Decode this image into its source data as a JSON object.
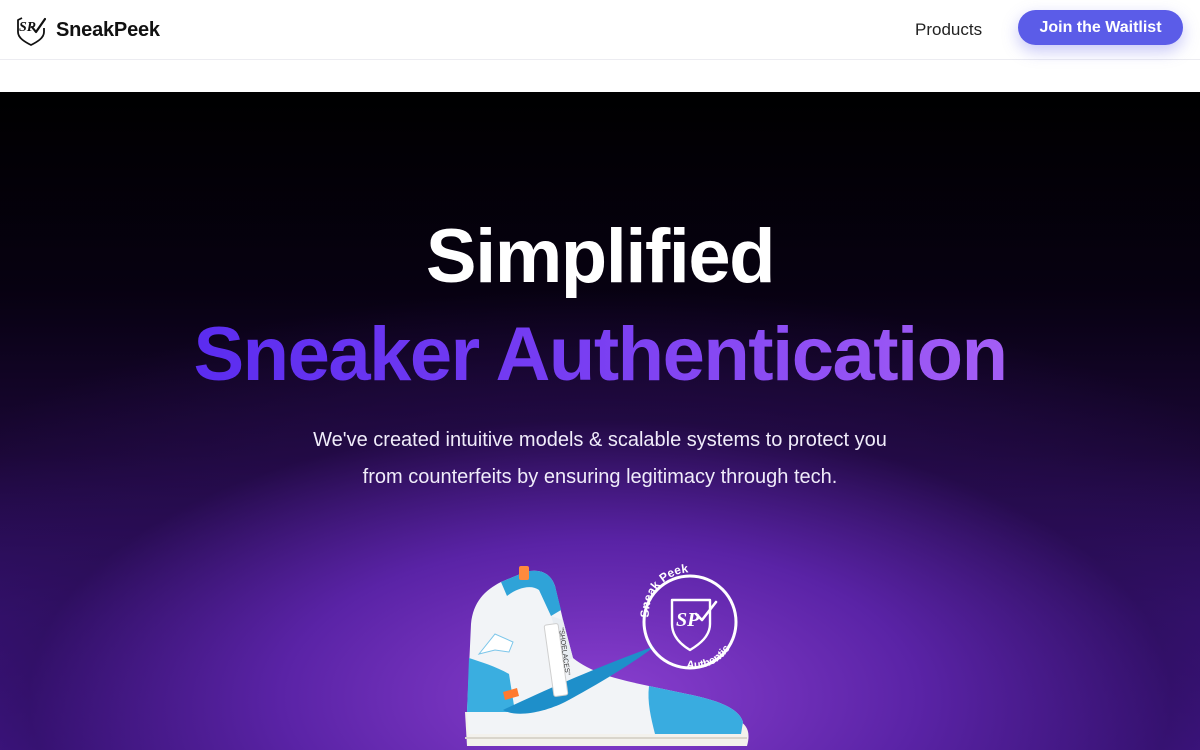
{
  "navbar": {
    "brand_name": "SneakPeek",
    "brand_logo_text": "SP",
    "nav_link": "Products",
    "cta_label": "Join the Waitlist"
  },
  "hero": {
    "title_line1": "Simplified",
    "title_line2": "Sneaker Authentication",
    "subtitle_line1": "We've created intuitive models & scalable systems to protect you",
    "subtitle_line2": "from counterfeits by ensuring legitimacy through tech."
  },
  "badge": {
    "top_text": "Sneak Peek",
    "bottom_text": "Authentic",
    "monogram": "SP"
  },
  "sneaker": {
    "lace_tag_text": "\"SHOELACES\""
  },
  "colors": {
    "accent": "#5b5ce8",
    "headline_gradient_start": "#5b2cf0",
    "headline_gradient_end": "#a45ef5",
    "hero_background": "#000000"
  },
  "icons": {
    "brand": "sp-checkmark-logo-icon",
    "badge": "authentic-seal-icon"
  }
}
